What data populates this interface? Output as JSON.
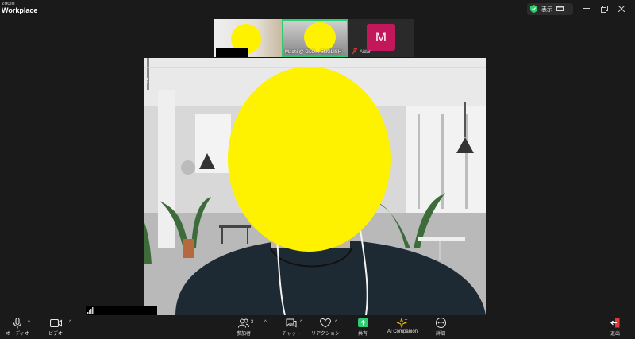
{
  "app": {
    "brand_small": "zoom",
    "brand_name": "Workplace"
  },
  "titlebar": {
    "view_label": "表示"
  },
  "thumbnails": [
    {
      "name": ""
    },
    {
      "name": "Machi @ GLO... ENGLISH"
    },
    {
      "name": "Aidan",
      "avatar_letter": "M",
      "muted": true
    }
  ],
  "toolbar": {
    "audio": "オーディオ",
    "video": "ビデオ",
    "participants": "参加者",
    "participants_count": "3",
    "chat": "チャット",
    "reactions": "リアクション",
    "share": "共有",
    "ai_companion": "AI Companion",
    "more": "詳細",
    "leave": "退出"
  },
  "colors": {
    "accent_green": "#2ecc71",
    "avatar_bg": "#c2185b",
    "leave_red": "#e53935",
    "ai_star": "#f5b400"
  }
}
